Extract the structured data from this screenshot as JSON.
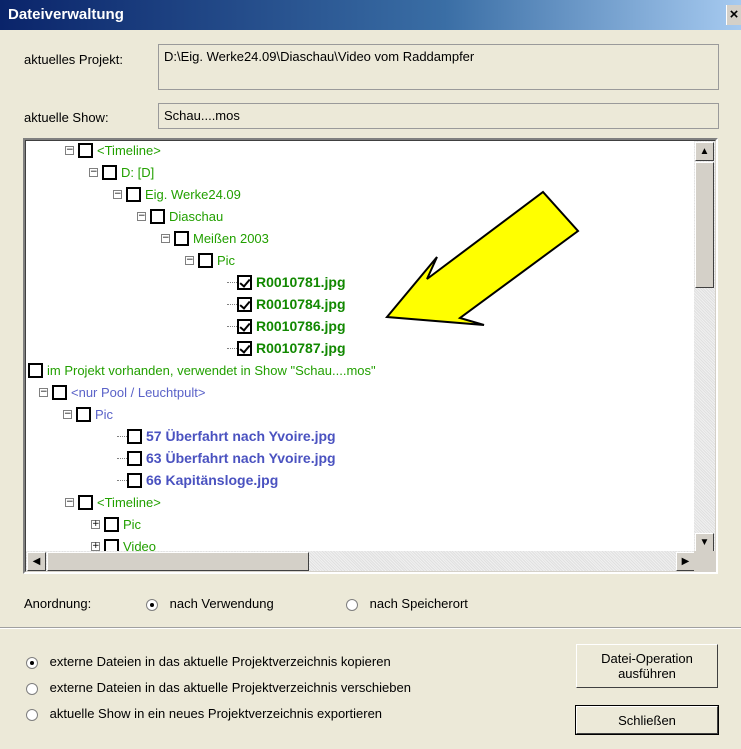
{
  "window": {
    "title": "Dateiverwaltung",
    "close_glyph": "×"
  },
  "project": {
    "label": "aktuelles Projekt:",
    "value": "D:\\Eig. Werke24.09\\Diaschau\\Video vom Raddampfer"
  },
  "show": {
    "label": "aktuelle Show:",
    "value": "Schau....mos"
  },
  "tree": {
    "items": [
      {
        "label": "<Timeline>",
        "style": "green",
        "exp": "−",
        "checked": false
      },
      {
        "label": "D: [D]",
        "style": "green",
        "exp": "−",
        "checked": false
      },
      {
        "label": "Eig. Werke24.09",
        "style": "green",
        "exp": "−",
        "checked": false
      },
      {
        "label": "Diaschau",
        "style": "green",
        "exp": "−",
        "checked": false
      },
      {
        "label": "Meißen 2003",
        "style": "green",
        "exp": "−",
        "checked": false
      },
      {
        "label": "Pic",
        "style": "green",
        "exp": "−",
        "checked": false
      },
      {
        "label": "R0010781.jpg",
        "style": "greenb",
        "exp": "",
        "checked": true
      },
      {
        "label": "R0010784.jpg",
        "style": "greenb",
        "exp": "",
        "checked": true
      },
      {
        "label": "R0010786.jpg",
        "style": "greenb",
        "exp": "",
        "checked": true
      },
      {
        "label": "R0010787.jpg",
        "style": "greenb",
        "exp": "",
        "checked": true
      },
      {
        "label": "im Projekt vorhanden, verwendet in Show \"Schau....mos\"",
        "style": "green",
        "exp": "−",
        "checked": false
      },
      {
        "label": "<nur Pool / Leuchtpult>",
        "style": "blue",
        "exp": "−",
        "checked": false
      },
      {
        "label": "Pic",
        "style": "blue",
        "exp": "−",
        "checked": false
      },
      {
        "label": "57 Überfahrt nach Yvoire.jpg",
        "style": "blueb",
        "exp": "",
        "checked": false
      },
      {
        "label": "63 Überfahrt nach Yvoire.jpg",
        "style": "blueb",
        "exp": "",
        "checked": false
      },
      {
        "label": "66 Kapitänsloge.jpg",
        "style": "blueb",
        "exp": "",
        "checked": false
      },
      {
        "label": "<Timeline>",
        "style": "green",
        "exp": "−",
        "checked": false
      },
      {
        "label": "Pic",
        "style": "green",
        "exp": "+",
        "checked": false
      },
      {
        "label": "Video",
        "style": "green",
        "exp": "+",
        "checked": false
      }
    ]
  },
  "arrangement": {
    "label": "Anordnung:",
    "options": [
      {
        "label": "nach Verwendung",
        "selected": true
      },
      {
        "label": "nach Speicherort",
        "selected": false
      }
    ]
  },
  "operations": [
    {
      "label": "externe Dateien in das aktuelle Projektverzeichnis kopieren",
      "selected": true
    },
    {
      "label": "externe Dateien in das aktuelle Projektverzeichnis verschieben",
      "selected": false
    },
    {
      "label": "aktuelle Show in ein neues Projektverzeichnis exportieren",
      "selected": false
    }
  ],
  "buttons": {
    "execute_line1": "Datei-Operation",
    "execute_line2": "ausführen",
    "close": "Schließen"
  },
  "annotation": {
    "arrow_color": "#ffff00"
  }
}
